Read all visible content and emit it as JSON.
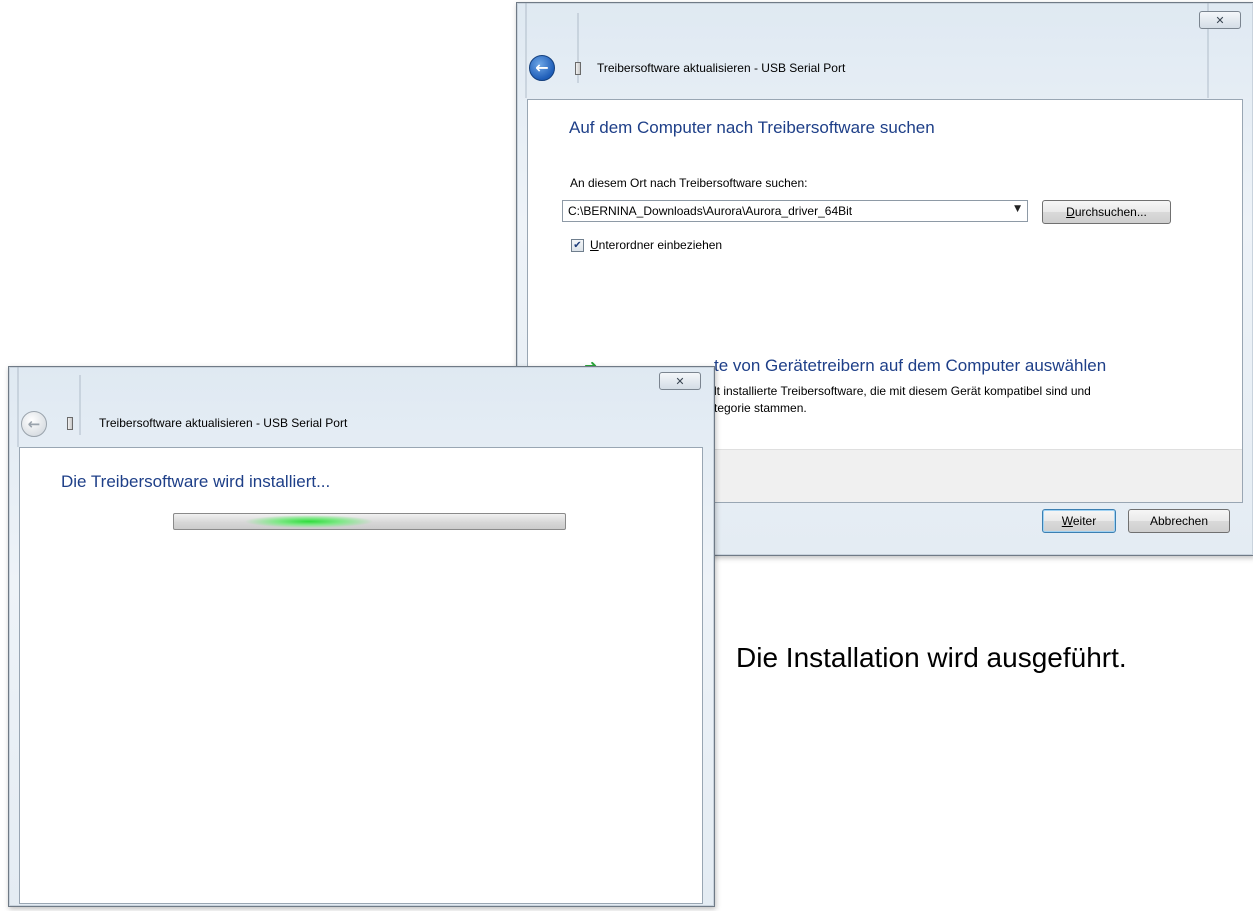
{
  "back_window": {
    "title": "Treibersoftware aktualisieren - USB Serial Port",
    "close_glyph": "✕",
    "heading": "Auf dem Computer nach Treibersoftware suchen",
    "search_label": "An diesem Ort nach Treibersoftware suchen:",
    "path_value": "C:\\BERNINA_Downloads\\Aurora\\Aurora_driver_64Bit",
    "browse_button": {
      "access_key": "D",
      "rest": "urchsuchen..."
    },
    "subfolder_checkbox": {
      "checked": true,
      "access_key": "U",
      "rest": "nterordner einbeziehen"
    },
    "list_option_title": "Aus einer Liste von Gerätetreibern auf dem Computer auswählen",
    "list_option_title_visible": "te von Gerätetreibern auf dem Computer auswählen",
    "list_option_desc_line1": "lt installierte Treibersoftware, die mit diesem Gerät kompatibel sind und",
    "list_option_desc_line2": "tegorie stammen.",
    "next_button": {
      "access_key": "W",
      "rest": "eiter"
    },
    "cancel_button": "Abbrechen"
  },
  "front_window": {
    "title": "Treibersoftware aktualisieren - USB Serial Port",
    "close_glyph": "✕",
    "heading": "Die Treibersoftware wird installiert...",
    "progress_state": "indeterminate"
  },
  "caption": "Die Installation wird ausgeführt.",
  "colors": {
    "heading_blue": "#1e3f88",
    "progress_green": "#2fdc3c",
    "back_arrow_blue": "#1e5db8"
  },
  "icons": {
    "back": "back-arrow-icon",
    "device": "usb-device-icon",
    "close": "close-icon",
    "next_option": "green-arrow-icon",
    "dropdown": "chevron-down-icon"
  }
}
